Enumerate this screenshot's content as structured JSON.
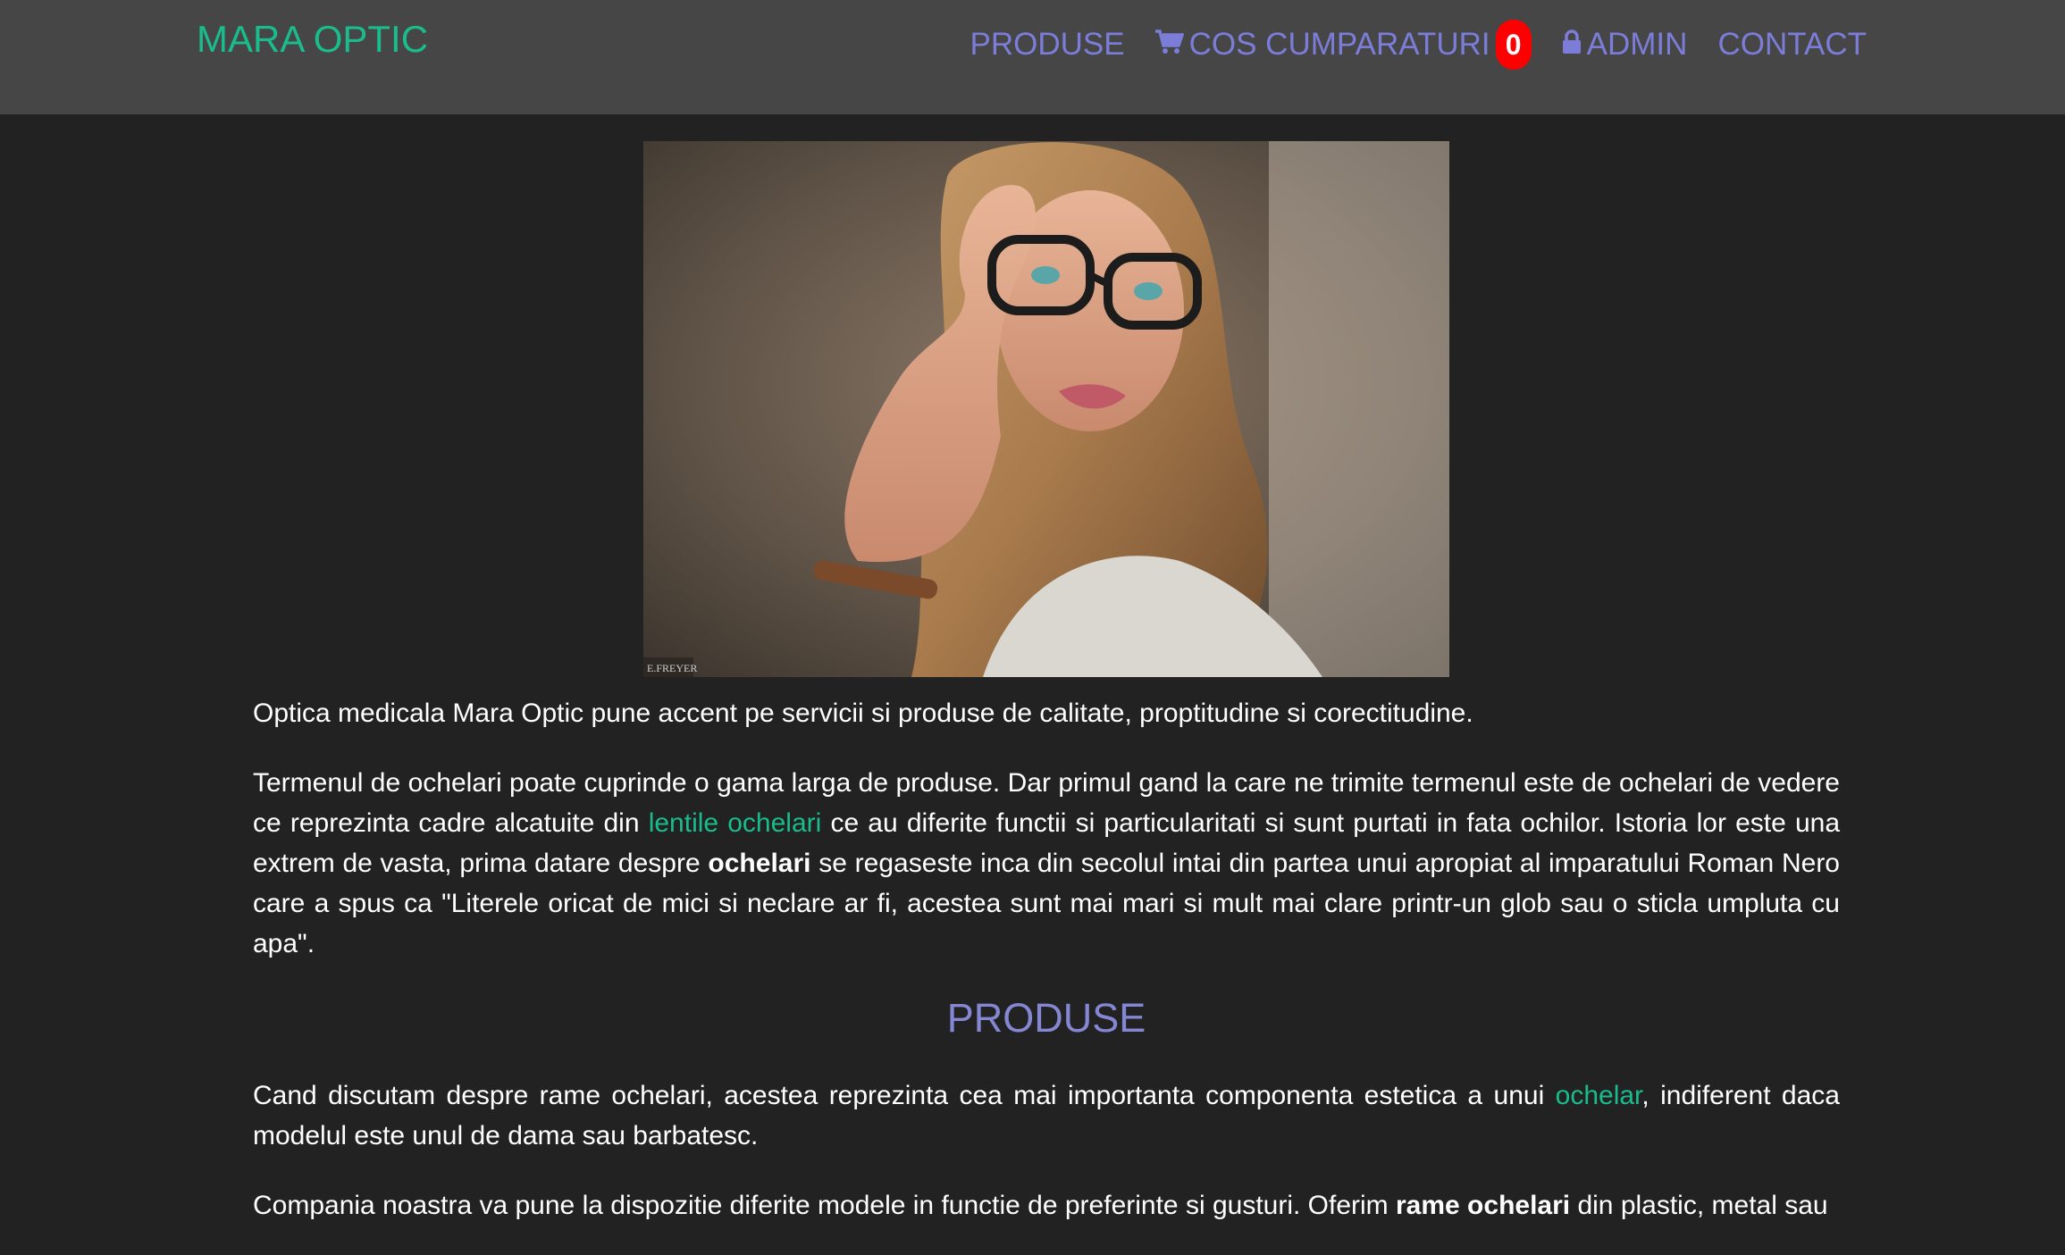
{
  "navbar": {
    "brand": "MARA OPTIC",
    "items": [
      {
        "label": "PRODUSE",
        "icon": null
      },
      {
        "label": "COS CUMPARATURI",
        "icon": "shopping-cart-icon",
        "badge": "0"
      },
      {
        "label": "ADMIN",
        "icon": "lock-icon"
      },
      {
        "label": "CONTACT",
        "icon": null
      }
    ]
  },
  "hero": {
    "watermark": "E.FREYER"
  },
  "intro": {
    "text": "Optica medicala Mara Optic pune accent pe servicii si produse de calitate, proptitudine si corectitudine."
  },
  "paragraph2": {
    "part1": "Termenul de ochelari poate cuprinde o gama larga de produse. Dar primul gand la care ne trimite termenul este de ochelari de vedere ce reprezinta cadre alcatuite din ",
    "link": "lentile ochelari",
    "part2": " ce au diferite functii si particularitati si sunt purtati in fata ochilor. Istoria lor este una extrem de vasta, prima datare despre ",
    "bold": "ochelari",
    "part3": " se regaseste inca din secolul intai din partea unui apropiat al imparatului Roman Nero care a spus ca \"Literele oricat de mici si neclare ar fi, acestea sunt mai mari si mult mai clare printr-un glob sau o sticla umpluta cu apa\"."
  },
  "produse_section": {
    "title": "PRODUSE",
    "p1_part1": "Cand discutam despre rame ochelari, acestea reprezinta cea mai importanta componenta estetica a unui ",
    "p1_link": "ochelar",
    "p1_part2": ", indiferent daca modelul este unul de dama sau barbatesc.",
    "p2_part1": "Compania noastra va pune la dispozitie diferite modele in functie de preferinte si gusturi. Oferim ",
    "p2_bold": "rame ochelari",
    "p2_part2": " din plastic, metal sau"
  },
  "colors": {
    "background": "#222222",
    "navbar": "#464646",
    "brand": "#1abc8c",
    "nav_link": "#7b7dd8",
    "badge": "#ff0000",
    "heading": "#8587d4"
  }
}
